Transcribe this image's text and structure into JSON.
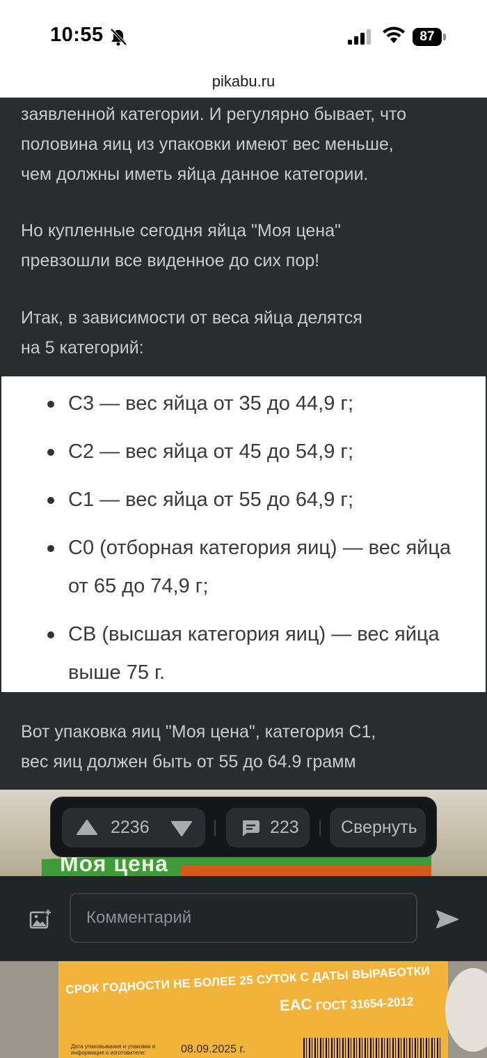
{
  "status_bar": {
    "time": "10:55",
    "battery": "87"
  },
  "browser": {
    "url": "pikabu.ru"
  },
  "article": {
    "para1": [
      "заявленной категории. И регулярно бывает, что",
      "половина яиц из упаковки имеют вес меньше,",
      "чем должны иметь яйца данное категории."
    ],
    "para2": [
      "Но купленные сегодня яйца \"Моя цена\"",
      "превзошли все виденное до сих пор!"
    ],
    "para3": [
      "Итак, в зависимости от веса яйца делятся",
      "на 5 категорий:"
    ],
    "categories": [
      "С3 — вес яйца от 35 до 44,9 г;",
      "С2 — вес яйца от 45 до 54,9 г;",
      "С1 — вес яйца от 55 до 64,9 г;",
      "С0 (отборная категория яиц) — вес яйца от 65 до 74,9 г;",
      "СВ (высшая категория яиц) — вес яйца выше 75 г."
    ],
    "para4": [
      "Вот упаковка яиц \"Моя цена\", категория С1,",
      "вес яиц должен быть от 55 до 64.9 грамм"
    ]
  },
  "photo_top": {
    "brand": "Моя цена"
  },
  "actions": {
    "rating": "2236",
    "comments_count": "223",
    "collapse_label": "Свернуть"
  },
  "comment_bar": {
    "placeholder": "Комментарий"
  },
  "photo_bottom": {
    "shelf_life": "СРОК ГОДНОСТИ НЕ БОЛЕЕ 25 СУТОК С ДАТЫ ВЫРАБОТКИ",
    "gost": "ГОСТ 31654-2012",
    "eac": "EAC",
    "packing_label": "Дата упаковывания и упаковки и информация о изготовителе:",
    "date": "08.09.2025 г."
  },
  "icons": {
    "mute": "bell-slash-icon",
    "signal": "cellular-signal-icon",
    "wifi": "wifi-icon",
    "upvote": "triangle-up-icon",
    "downvote": "triangle-down-icon",
    "comment": "comment-bubble-icon",
    "attach_image": "image-plus-icon",
    "send": "send-arrow-icon"
  },
  "colors": {
    "background": "#2a2d30",
    "text": "#c9ccce",
    "card": "#ffffff",
    "action_bar": "#141617"
  }
}
